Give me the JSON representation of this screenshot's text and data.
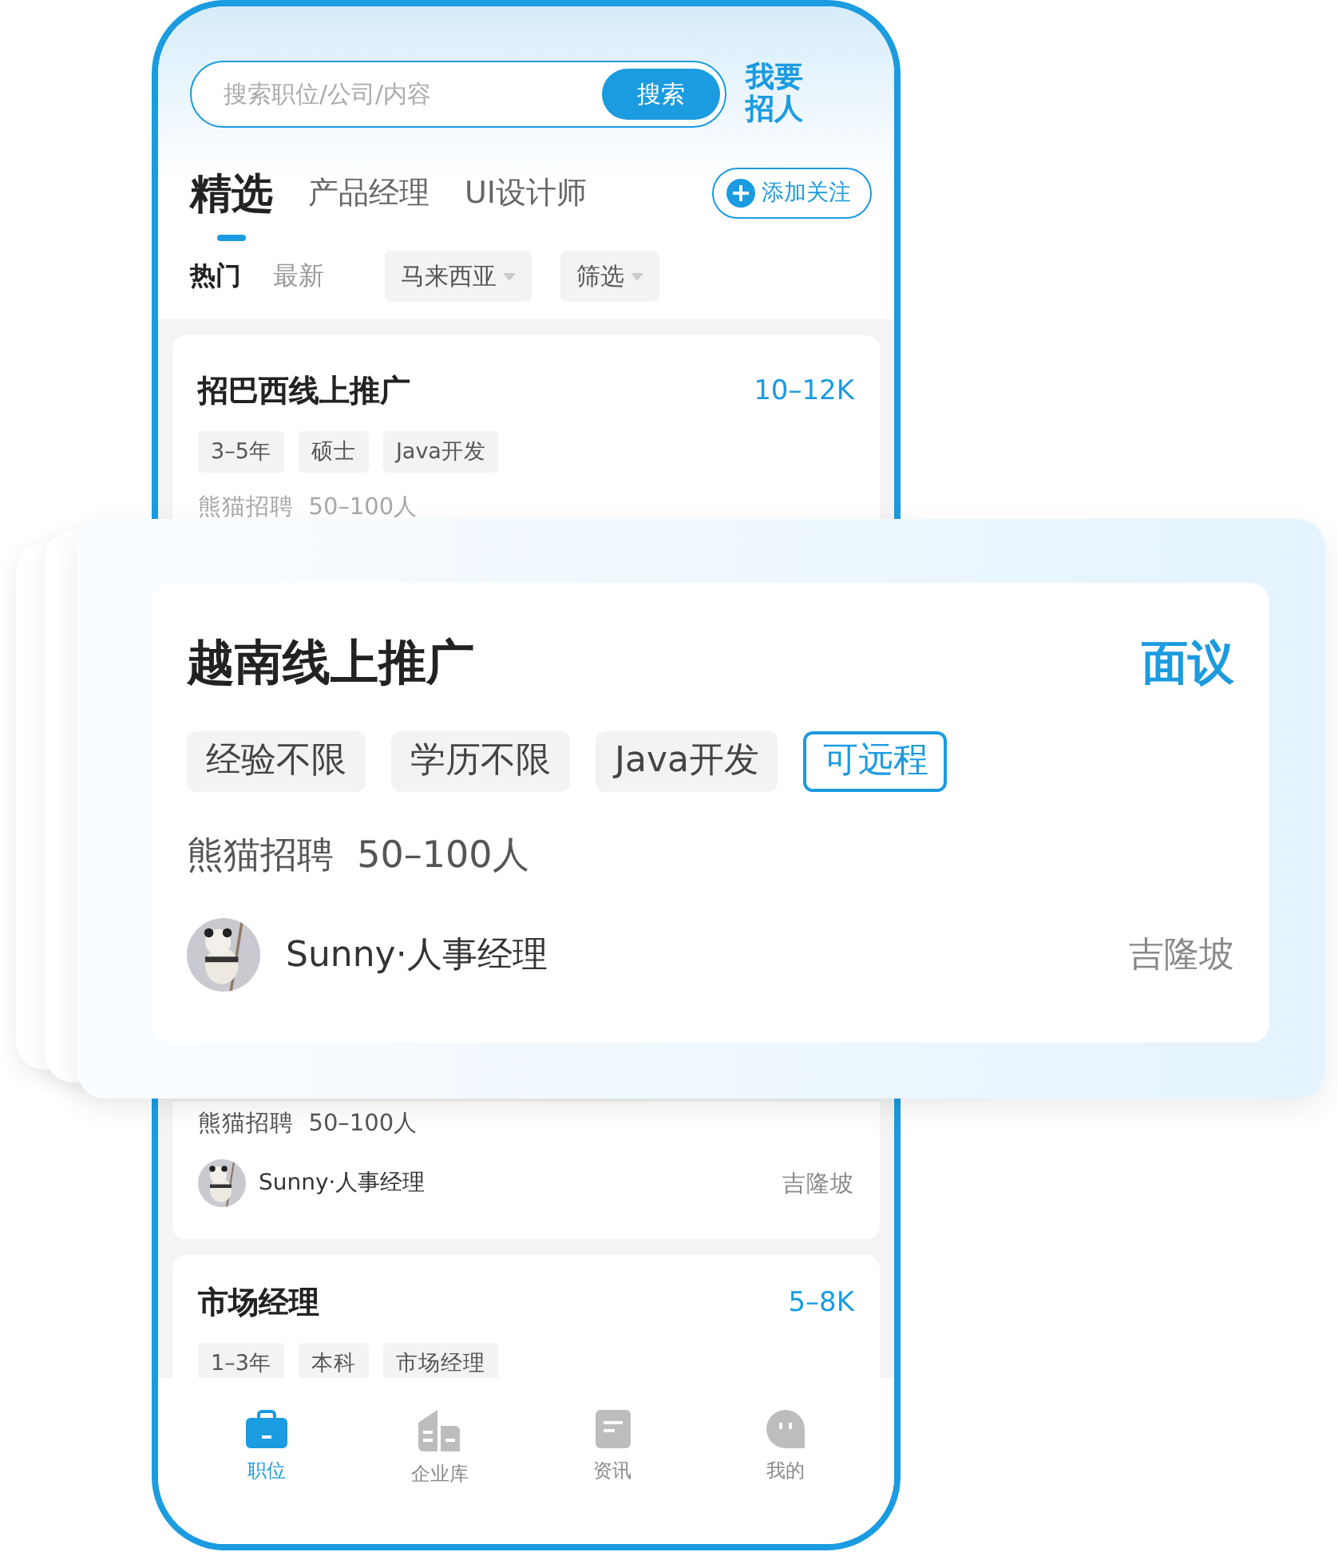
{
  "search": {
    "placeholder": "搜索职位/公司/内容",
    "button": "搜索"
  },
  "post_job": "我要招人",
  "tabs": [
    {
      "label": "精选",
      "selected": true
    },
    {
      "label": "产品经理",
      "selected": false
    },
    {
      "label": "UI设计师",
      "selected": false
    }
  ],
  "follow_button": "添加关注",
  "sort": [
    {
      "label": "热门",
      "selected": true
    },
    {
      "label": "最新",
      "selected": false
    }
  ],
  "filters": [
    "马来西亚",
    "筛选"
  ],
  "jobs": [
    {
      "title": "招巴西线上推广",
      "salary": "10–12K",
      "tags": [
        "3–5年",
        "硕士",
        "Java开发"
      ],
      "company": "熊猫招聘  50–100人",
      "faded": true
    },
    {
      "company": "熊猫招聘  50–100人",
      "recruiter": "Sunny·人事经理",
      "location": "吉隆坡"
    },
    {
      "title": "市场经理",
      "salary": "5–8K",
      "tags": [
        "1–3年",
        "本科",
        "市场经理"
      ]
    }
  ],
  "featured": {
    "title": "越南线上推广",
    "salary": "面议",
    "tags": [
      {
        "label": "经验不限",
        "kind": "plain"
      },
      {
        "label": "学历不限",
        "kind": "plain"
      },
      {
        "label": "Java开发",
        "kind": "plain"
      },
      {
        "label": "可远程",
        "kind": "highlight"
      }
    ],
    "company": "熊猫招聘  50–100人",
    "recruiter": "Sunny·人事经理",
    "location": "吉隆坡"
  },
  "nav": [
    {
      "label": "职位",
      "kind": "briefcase",
      "selected": true
    },
    {
      "label": "企业库",
      "kind": "building",
      "selected": false
    },
    {
      "label": "资讯",
      "kind": "document",
      "selected": false
    },
    {
      "label": "我的",
      "kind": "profile",
      "selected": false
    }
  ]
}
